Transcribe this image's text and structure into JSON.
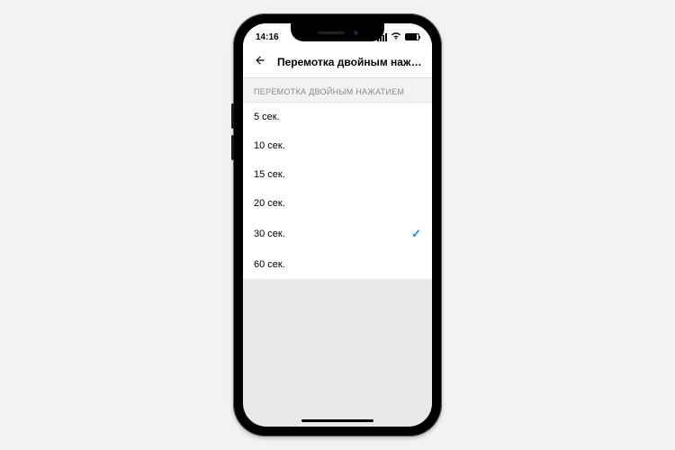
{
  "statusbar": {
    "time": "14:16"
  },
  "header": {
    "title": "Перемотка двойным нажатием"
  },
  "section": {
    "label": "ПЕРЕМОТКА ДВОЙНЫМ НАЖАТИЕМ"
  },
  "options": [
    {
      "label": "5 сек.",
      "selected": false
    },
    {
      "label": "10 сек.",
      "selected": false
    },
    {
      "label": "15 сек.",
      "selected": false
    },
    {
      "label": "20 сек.",
      "selected": false
    },
    {
      "label": "30 сек.",
      "selected": true
    },
    {
      "label": "60 сек.",
      "selected": false
    }
  ]
}
